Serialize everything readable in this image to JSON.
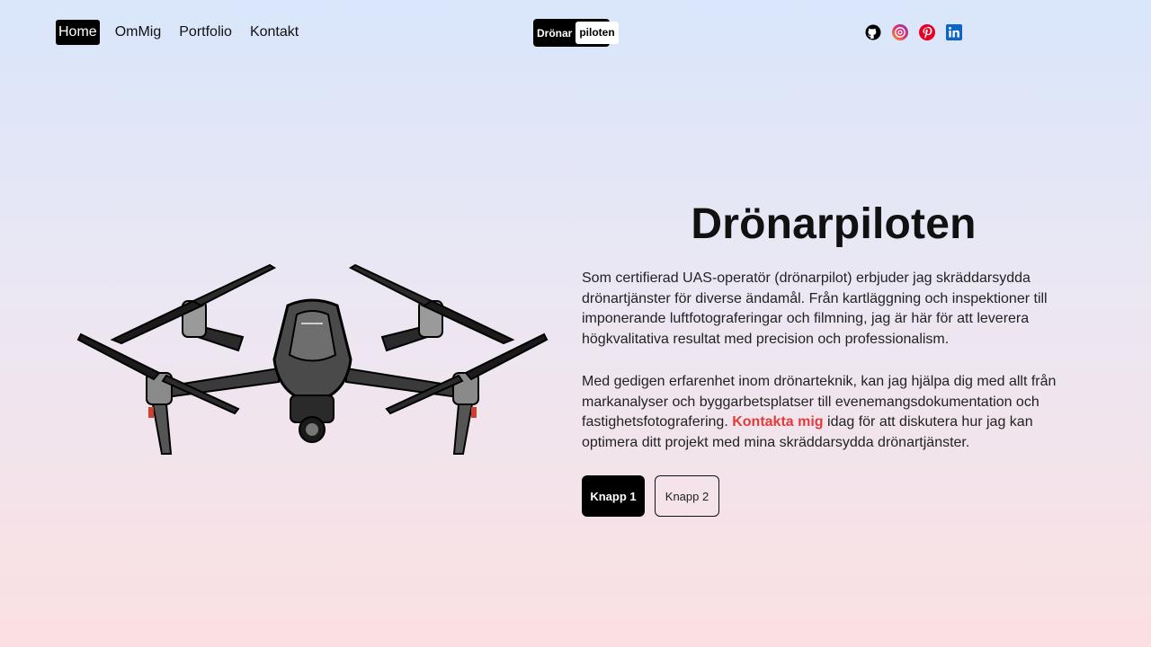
{
  "nav": {
    "items": [
      "Home",
      "OmMig",
      "Portfolio",
      "Kontakt"
    ],
    "active": "Home"
  },
  "logo": {
    "part1": "Drönar",
    "part2": "piloten"
  },
  "social": {
    "icons": [
      "github-icon",
      "dribbble-icon",
      "pinterest-icon",
      "linkedin-icon"
    ],
    "colors": {
      "github": "#000000",
      "dribbble": "#e1306c",
      "pinterest": "#e60023",
      "linkedin": "#0a66c2"
    }
  },
  "hero": {
    "title": "Drönarpiloten",
    "paragraph1": "Som certifierad UAS-operatör (drönarpilot) erbjuder jag skräddarsydda drönartjänster för diverse ändamål. Från kartläggning och inspektioner till imponerande luftfotograferingar och filmning, jag är här för att leverera högkvalitativa resultat med precision och professionalism.",
    "paragraph2_before": "Med gedigen erfarenhet inom drönarteknik, kan jag hjälpa dig med allt från markanalyser och byggarbetsplatser till evenemangsdokumentation och fastighetsfotografering. ",
    "paragraph2_link": "Kontakta mig",
    "paragraph2_after": " idag för att diskutera hur jag kan optimera ditt projekt med mina skräddarsydda drönartjänster.",
    "button1": "Knapp 1",
    "button2": "Knapp 2"
  },
  "colors": {
    "accent": "#e33b3b",
    "bg_top": "#d9e6fb",
    "bg_bottom": "#fbe0e2"
  }
}
